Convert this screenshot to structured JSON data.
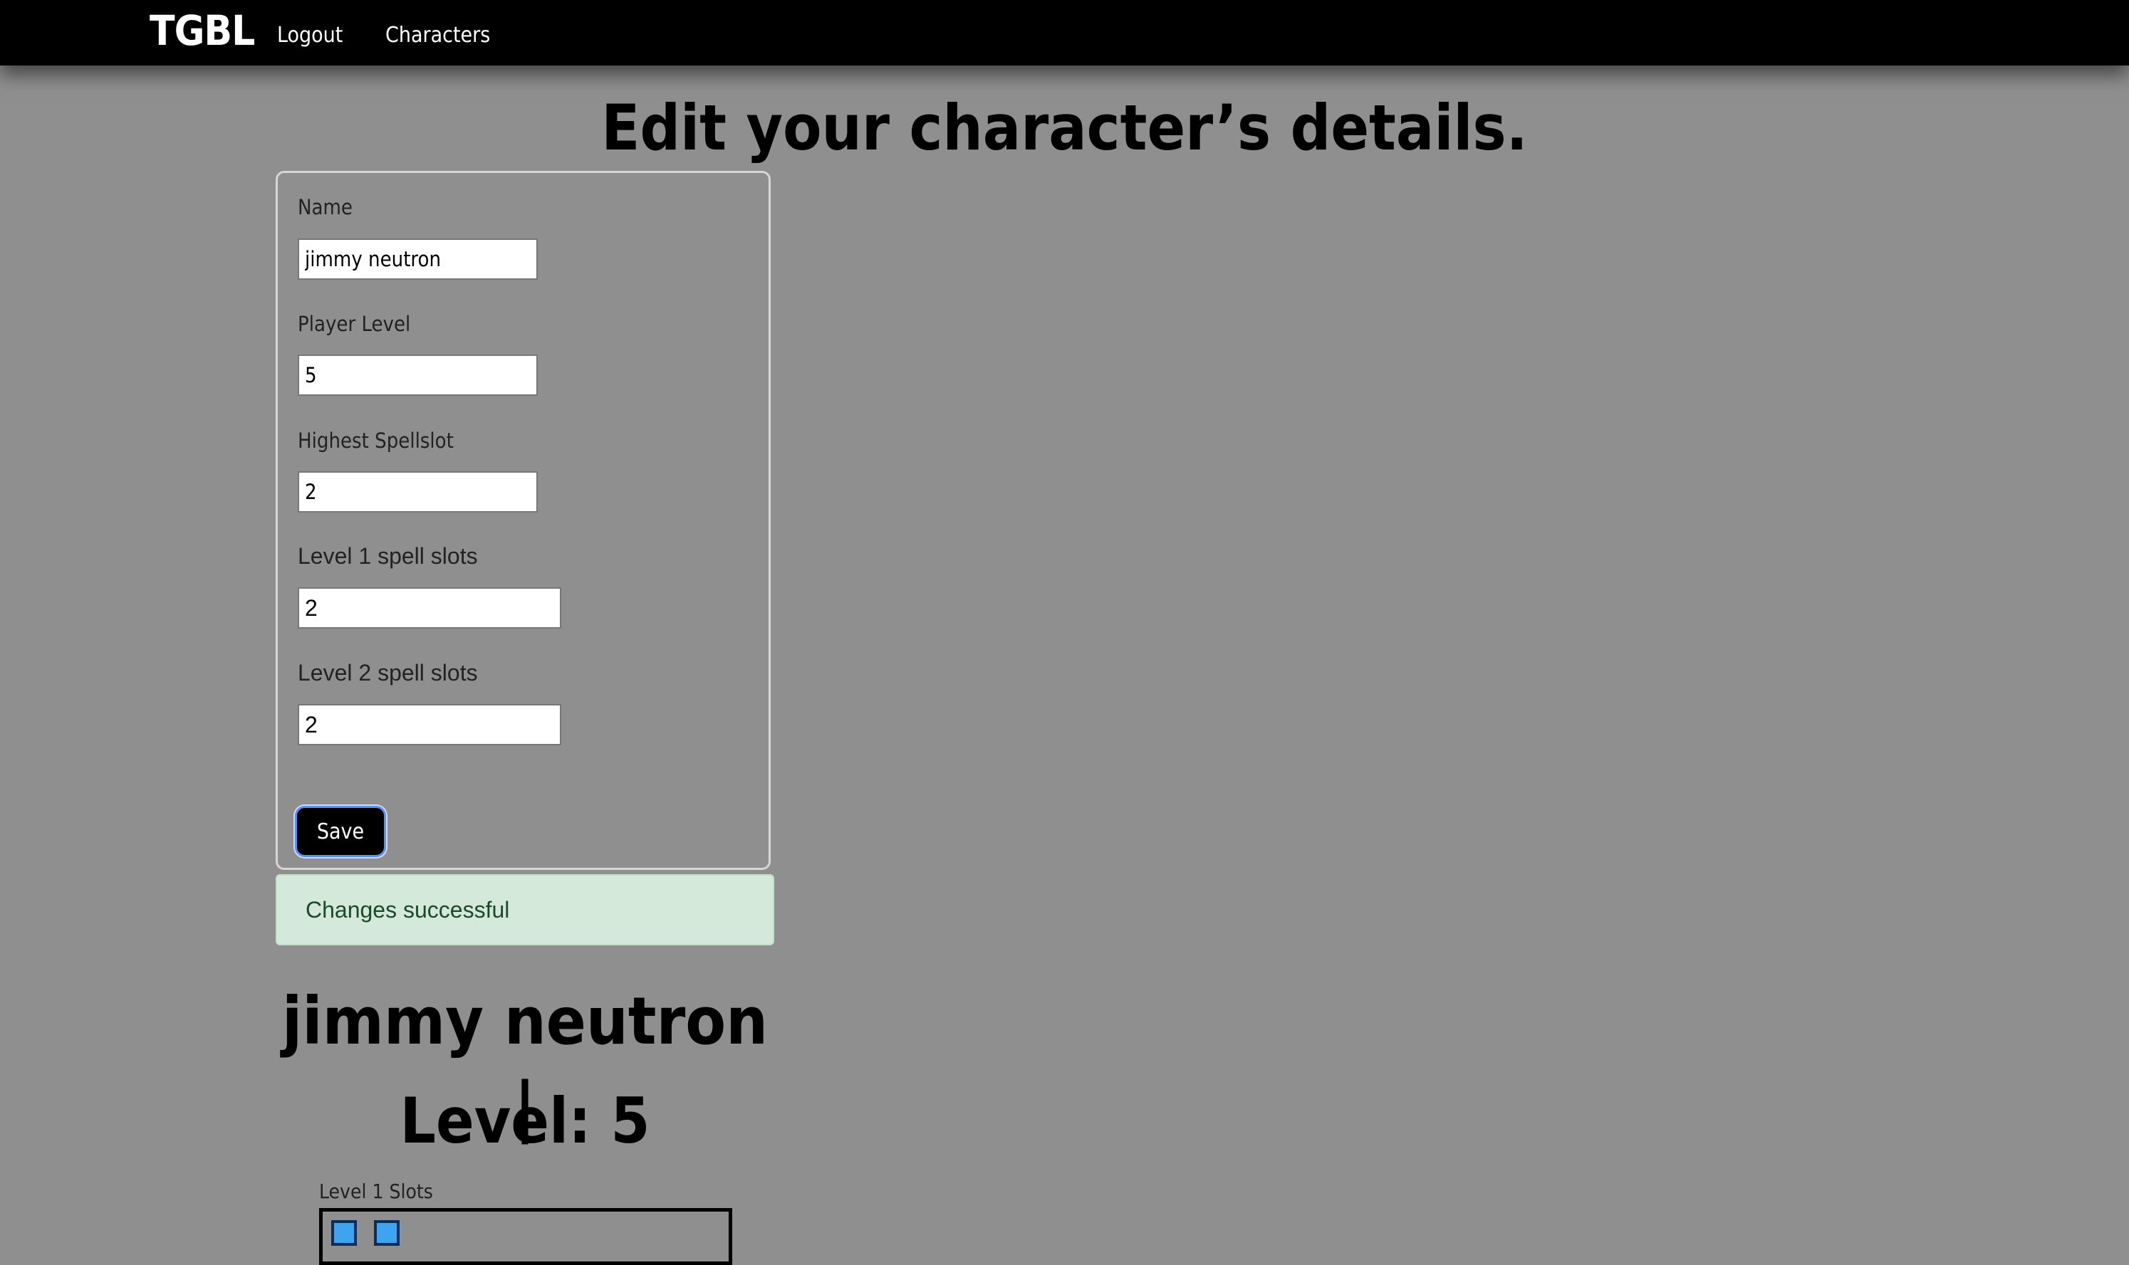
{
  "navbar": {
    "brand": "TGBL",
    "links": [
      {
        "label": "Logout"
      },
      {
        "label": "Characters"
      }
    ]
  },
  "page": {
    "title": "Edit your character’s details."
  },
  "form": {
    "fields": [
      {
        "label": "Name",
        "value": "jimmy neutron"
      },
      {
        "label": "Player Level",
        "value": "5"
      },
      {
        "label": "Highest Spellslot",
        "value": "2"
      },
      {
        "label": "Level 1 spell slots",
        "value": "2"
      },
      {
        "label": "Level 2 spell slots",
        "value": "2"
      }
    ],
    "save_label": "Save"
  },
  "alert": {
    "message": "Changes successful"
  },
  "character": {
    "name_line": "jimmy neutron |",
    "level_line": "Level: 5",
    "slots": [
      {
        "label": "Level 1 Slots",
        "count": 2
      }
    ]
  },
  "colors": {
    "background": "#8f8f8f",
    "navbar": "#000000",
    "alert_bg": "#d4e9d9",
    "alert_text": "#1b4a2a",
    "slot_fill": "#3ea4f0",
    "save_border": "#5b8df2"
  }
}
